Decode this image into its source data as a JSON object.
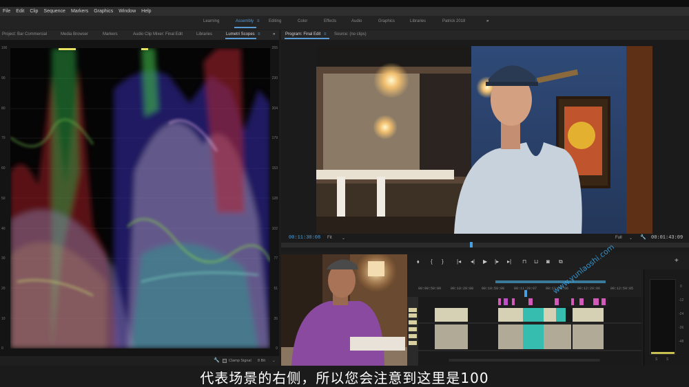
{
  "menubar": {
    "items": [
      "File",
      "Edit",
      "Clip",
      "Sequence",
      "Markers",
      "Graphics",
      "Window",
      "Help"
    ]
  },
  "workspaces": {
    "tabs": [
      "Learning",
      "Assembly",
      "Editing",
      "Color",
      "Effects",
      "Audio",
      "Graphics",
      "Libraries",
      "Patrick 2018"
    ],
    "active": "Assembly",
    "more": "»"
  },
  "left_panel": {
    "tabs": [
      "Project: Bar Commercial",
      "Media Browser",
      "Markers",
      "Audio Clip Mixer: Final Edit",
      "Libraries",
      "Lumetri Scopes"
    ],
    "active_tab": "Lumetri Scopes",
    "more": "»",
    "scale_left": [
      "100",
      "90",
      "80",
      "70",
      "60",
      "50",
      "40",
      "30",
      "20",
      "10",
      "0"
    ],
    "scale_right": [
      "255",
      "230",
      "204",
      "179",
      "153",
      "128",
      "102",
      "77",
      "51",
      "26",
      "0"
    ],
    "footer": {
      "clamp_signal": "Clamp Signal",
      "bit_depth": "8 Bit"
    }
  },
  "program": {
    "tabs": [
      "Program: Final Edit",
      "Source: (no clips)"
    ],
    "active_tab": "Program: Final Edit",
    "timecode_current": "00:11:30:08",
    "zoom": "Fit",
    "quality": "Full",
    "timecode_duration": "00:01:43:09"
  },
  "transport": {
    "buttons": [
      "marker-icon",
      "in-point-icon",
      "out-point-icon",
      "go-to-in-icon",
      "step-back-icon",
      "play-icon",
      "step-forward-icon",
      "go-to-out-icon",
      "lift-icon",
      "extract-icon",
      "export-frame-icon",
      "comparison-view-icon",
      "add-icon"
    ]
  },
  "timeline": {
    "times": [
      "00:09:59:09",
      "00:10:29:08",
      "00:10:59:08",
      "00:11:29:07",
      "00:11:59:06",
      "00:12:29:06",
      "00:12:59:05"
    ]
  },
  "meter": {
    "scale": [
      "0",
      "-12",
      "-24",
      "-36",
      "-48"
    ],
    "solo": [
      "S",
      "S"
    ]
  },
  "subtitle": "代表场景的右侧，所以您会注意到这里是100",
  "watermark": "www.yunlaoshi.com"
}
